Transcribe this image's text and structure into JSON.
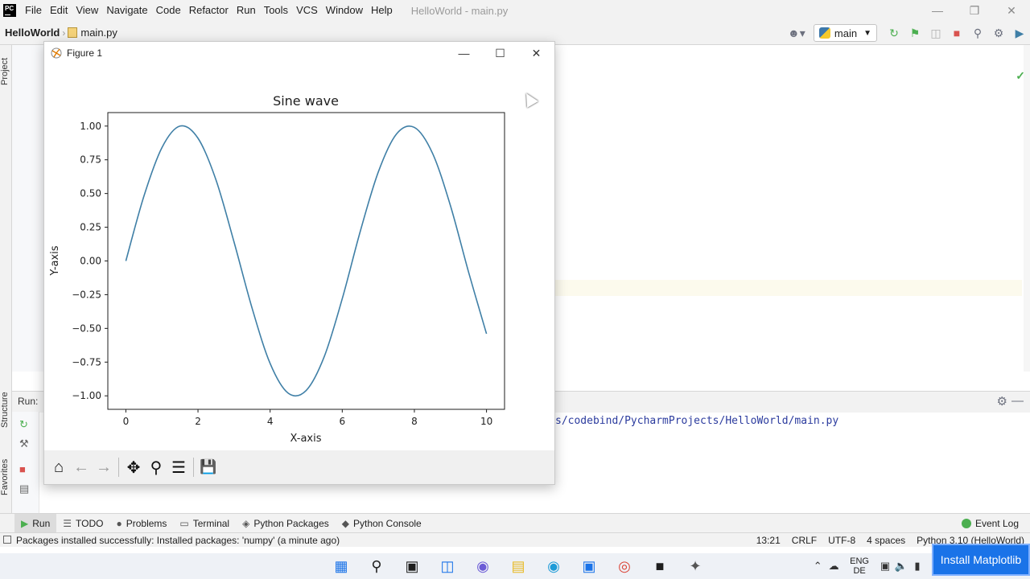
{
  "window": {
    "logo_text": "PC",
    "title": "HelloWorld - main.py",
    "menu": [
      "File",
      "Edit",
      "View",
      "Navigate",
      "Code",
      "Refactor",
      "Run",
      "Tools",
      "VCS",
      "Window",
      "Help"
    ]
  },
  "navbar": {
    "project": "HelloWorld",
    "file": "main.py",
    "run_config": "main"
  },
  "sidebar": {
    "project_label": "Project",
    "structure_label": "Structure",
    "favorites_label": "Favorites"
  },
  "figure": {
    "title": "Figure 1",
    "toolbar": {
      "home": "⌂",
      "back": "←",
      "forward": "→",
      "pan": "✥",
      "zoom": "⚲",
      "configure": "☰",
      "save": "💾"
    }
  },
  "run_panel": {
    "label": "Run:",
    "output_path": "s/codebind/PycharmProjects/HelloWorld/main.py"
  },
  "tool_tabs": [
    {
      "label": "Run",
      "icon": "run-icon",
      "glyph": "▶",
      "active": true
    },
    {
      "label": "TODO",
      "icon": "todo-icon",
      "glyph": "☰",
      "active": false
    },
    {
      "label": "Problems",
      "icon": "problems-icon",
      "glyph": "●",
      "active": false
    },
    {
      "label": "Terminal",
      "icon": "terminal-icon",
      "glyph": "▭",
      "active": false
    },
    {
      "label": "Python Packages",
      "icon": "packages-icon",
      "glyph": "◈",
      "active": false
    },
    {
      "label": "Python Console",
      "icon": "console-icon",
      "glyph": "◆",
      "active": false
    }
  ],
  "event_log": "Event Log",
  "status": {
    "message": "Packages installed successfully: Installed packages: 'numpy' (a minute ago)",
    "position": "13:21",
    "line_ending": "CRLF",
    "encoding": "UTF-8",
    "indent": "4 spaces",
    "interpreter": "Python 3.10 (HelloWorld)"
  },
  "taskbar": {
    "lang_top": "ENG",
    "lang_bottom": "DE"
  },
  "install_badge": "Install Matplotlib",
  "colors": {
    "line": "#3f7fa6",
    "accent": "#1a73e8"
  },
  "chart_data": {
    "type": "line",
    "title": "Sine wave",
    "xlabel": "X-axis",
    "ylabel": "Y-axis",
    "xlim": [
      -0.5,
      10.5
    ],
    "ylim": [
      -1.1,
      1.1
    ],
    "xticks": [
      0,
      2,
      4,
      6,
      8,
      10
    ],
    "xtick_labels": [
      "0",
      "2",
      "4",
      "6",
      "8",
      "10"
    ],
    "yticks": [
      1.0,
      0.75,
      0.5,
      0.25,
      0.0,
      -0.25,
      -0.5,
      -0.75,
      -1.0
    ],
    "ytick_labels": [
      "1.00",
      "0.75",
      "0.50",
      "0.25",
      "0.00",
      "−0.25",
      "−0.50",
      "−0.75",
      "−1.00"
    ],
    "grid": false,
    "series": [
      {
        "x": [
          0,
          0.5,
          1,
          1.5,
          2,
          2.5,
          3,
          3.5,
          4,
          4.5,
          5,
          5.5,
          6,
          6.5,
          7,
          7.5,
          8,
          8.5,
          9,
          9.5,
          10
        ],
        "y": [
          0.0,
          0.48,
          0.84,
          1.0,
          0.91,
          0.6,
          0.14,
          -0.35,
          -0.76,
          -0.98,
          -0.96,
          -0.71,
          -0.28,
          0.22,
          0.66,
          0.94,
          0.99,
          0.8,
          0.41,
          -0.08,
          -0.54
        ]
      }
    ]
  }
}
